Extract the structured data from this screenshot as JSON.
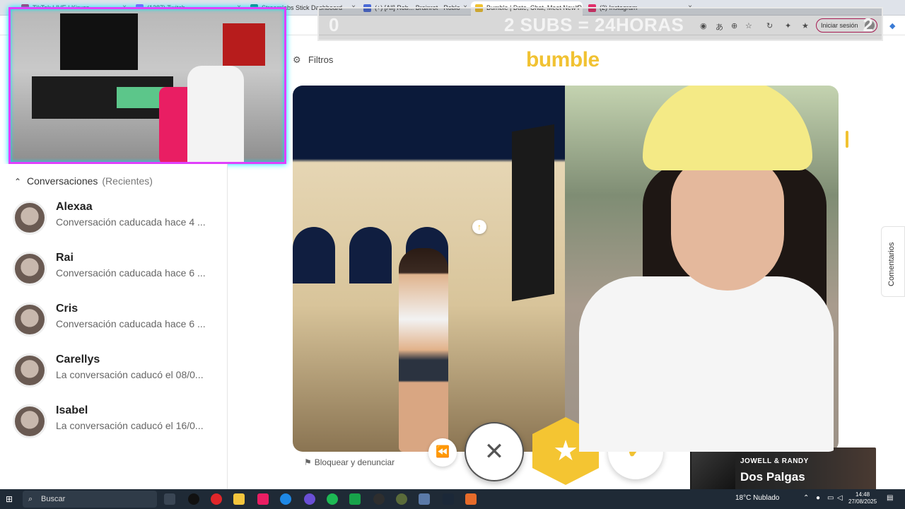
{
  "browser": {
    "tabs": [
      {
        "label": "TikTok LIVE | Kiruzz",
        "color": "#c2185b"
      },
      {
        "label": "(1287) Twitch",
        "color": "#9146ff"
      },
      {
        "label": "Streamlabs Stick Dashboard",
        "color": "#0b7a75"
      },
      {
        "label": "(+) [All] Rob... Brainrot - Roblo",
        "color": "#4b6bd6"
      },
      {
        "label": "Bumble | Date, Chat, Meet New P",
        "color": "#f1c232"
      },
      {
        "label": "(2) Instagram",
        "color": "#e1306c"
      }
    ],
    "signin_label": "Iniciar sesión"
  },
  "stream_overlay": {
    "left_count": "0",
    "goal_text": "2 SUBS = 24HORAS",
    "right_count": "2"
  },
  "conversations": {
    "heading": "Conversaciones",
    "subheading": "(Recientes)",
    "items": [
      {
        "name": "Alexaa",
        "status": "Conversación caducada hace 4 ..."
      },
      {
        "name": "Rai",
        "status": "Conversación caducada hace 6 ..."
      },
      {
        "name": "Cris",
        "status": "Conversación caducada hace 6 ..."
      },
      {
        "name": "Carellys",
        "status": "La conversación caducó el 08/0..."
      },
      {
        "name": "Isabel",
        "status": "La conversación caducó el 16/0..."
      }
    ]
  },
  "main": {
    "filters_label": "Filtros",
    "logo_text": "bumble",
    "report_label": "Bloquear y denunciar",
    "comments_label": "Comentarios",
    "accent_color": "#f1c232"
  },
  "actions": {
    "rewind_icon": "rewind-icon",
    "pass_icon": "close-icon",
    "superlike_icon": "star-icon",
    "like_icon": "check-icon"
  },
  "now_playing": {
    "artist": "JOWELL & RANDY",
    "song": "Dos Palgas"
  },
  "taskbar": {
    "search_placeholder": "Buscar",
    "weather": "18°C  Nublado",
    "time": "14:48",
    "date": "27/08/2025"
  }
}
